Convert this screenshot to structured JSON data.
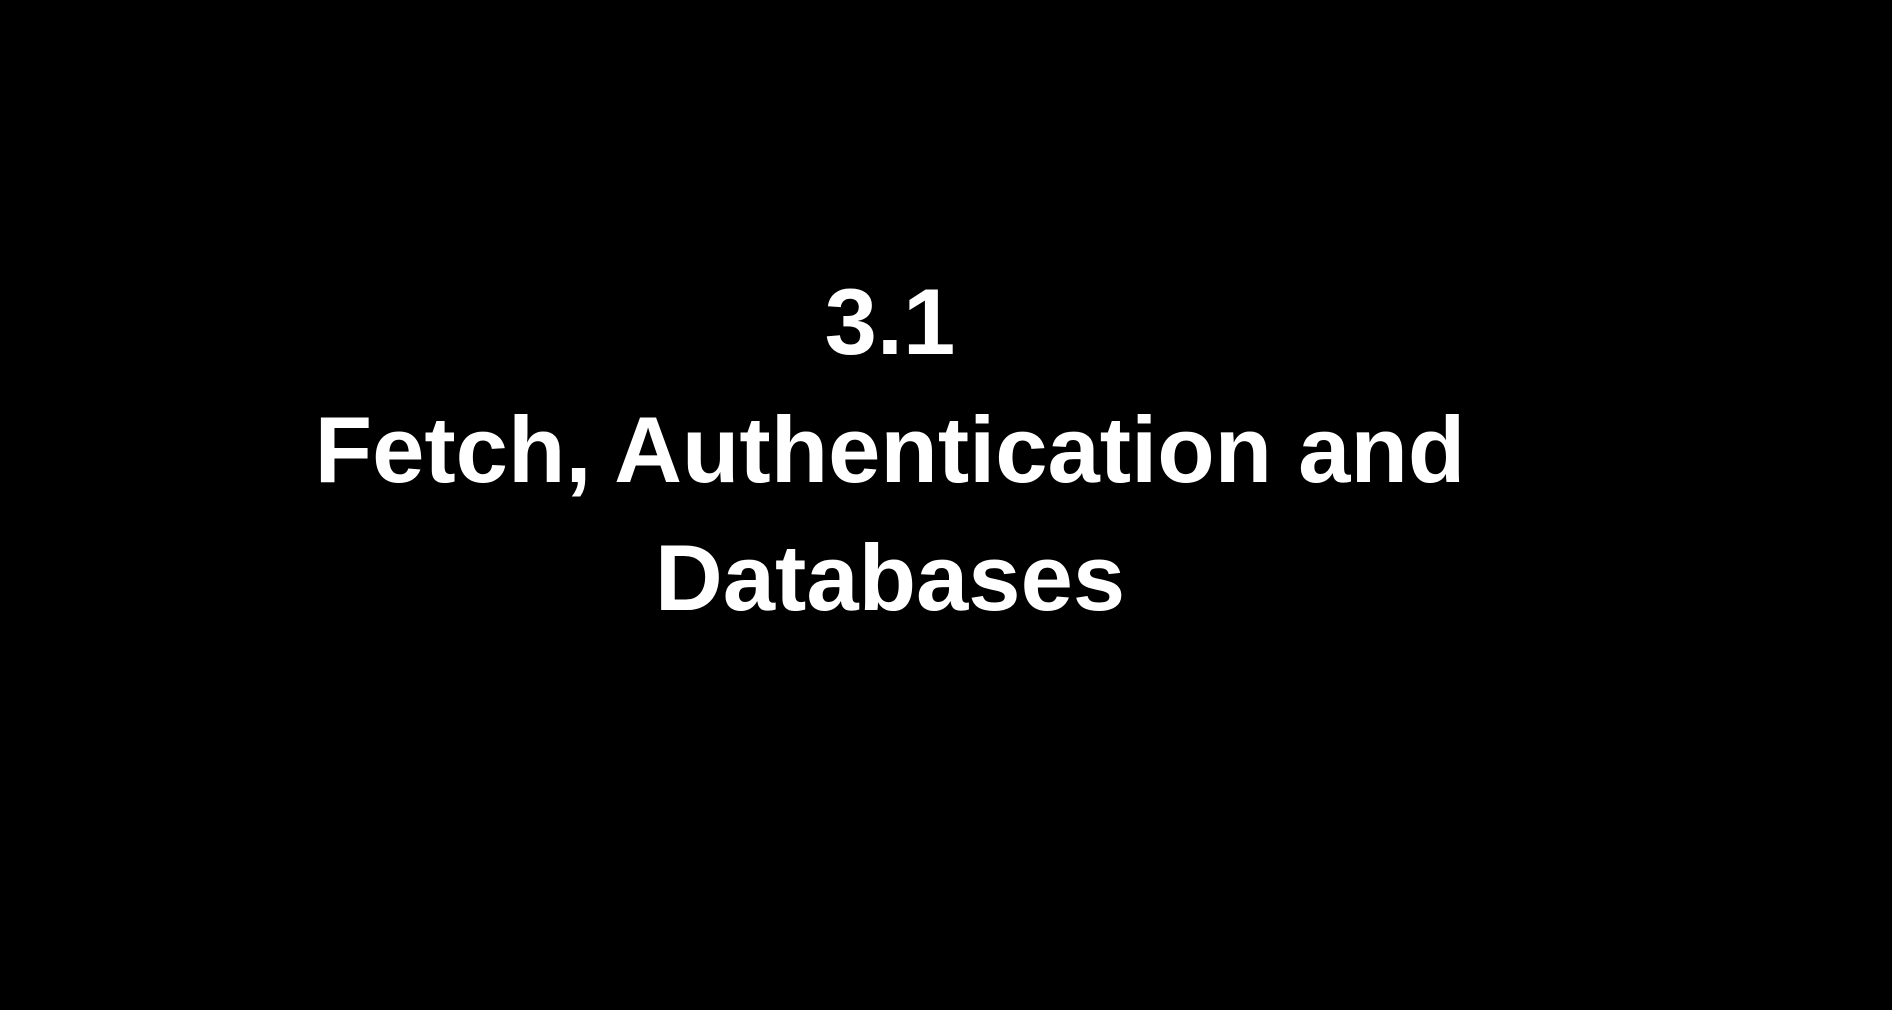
{
  "slide": {
    "section_number": "3.1",
    "title_line_1": "Fetch, Authentication and",
    "title_line_2": "Databases"
  },
  "colors": {
    "background": "#000000",
    "text": "#ffffff"
  }
}
